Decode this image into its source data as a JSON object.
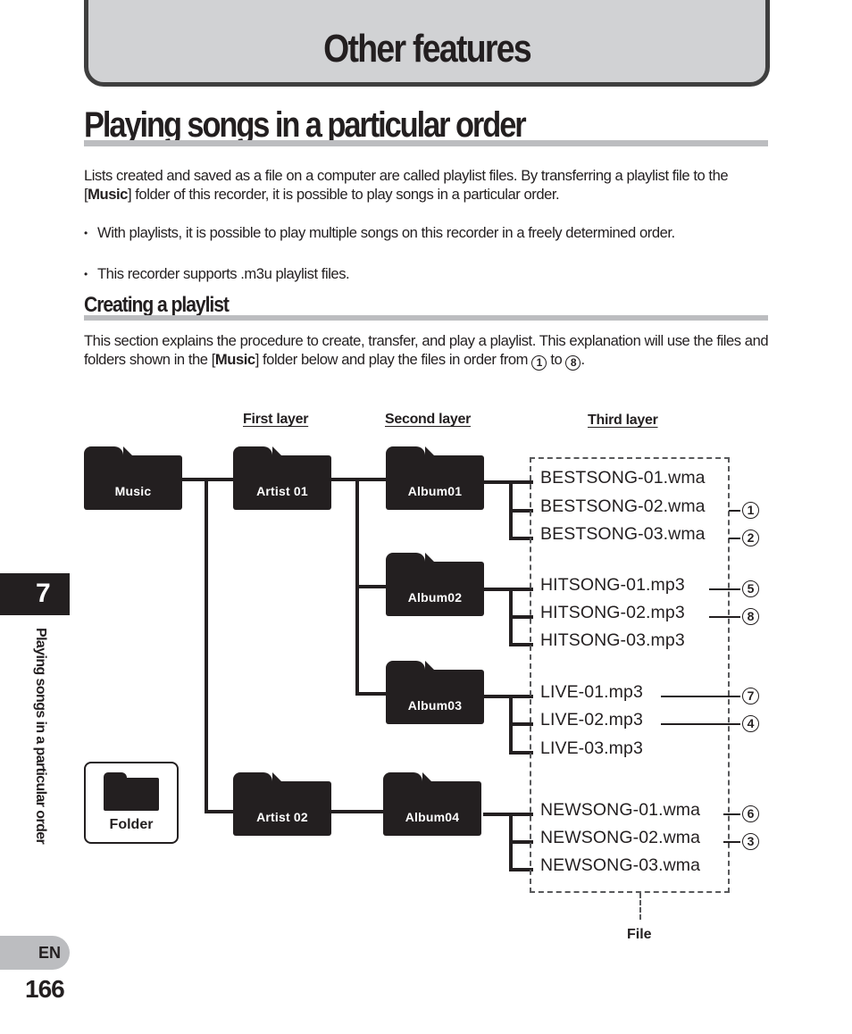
{
  "chapter": {
    "title": "Other features",
    "number": "7",
    "side_title": "Playing songs in a particular order"
  },
  "section": {
    "title": "Playing songs in a particular order",
    "intro_pre": "Lists created and saved as a file on a computer are called playlist files. By transferring a playlist file to the [",
    "intro_bold": "Music",
    "intro_post": "] folder of this recorder, it is possible to play songs in a particular order.",
    "bullets": [
      "With playlists, it is possible to play multiple songs on this recorder in a freely determined order.",
      "This recorder supports .m3u playlist files."
    ]
  },
  "subsection": {
    "title": "Creating a playlist",
    "text_pre": "This section explains the procedure to create, transfer, and play a playlist. This explanation will use the files and folders shown in the [",
    "text_bold": "Music",
    "text_mid": "] folder below and play the files in order from ",
    "order_start": "1",
    "text_to": " to ",
    "order_end": "8",
    "text_end": "."
  },
  "diagram": {
    "layer_labels": [
      "First layer",
      "Second layer",
      "Third layer"
    ],
    "root_folder": "Music",
    "folders": {
      "artist01": "Artist 01",
      "artist02": "Artist 02",
      "album01": "Album01",
      "album02": "Album02",
      "album03": "Album03",
      "album04": "Album04"
    },
    "files": [
      {
        "name": "BESTSONG-01.wma",
        "order": null
      },
      {
        "name": "BESTSONG-02.wma",
        "order": "1"
      },
      {
        "name": "BESTSONG-03.wma",
        "order": "2"
      },
      {
        "name": "HITSONG-01.mp3",
        "order": "5"
      },
      {
        "name": "HITSONG-02.mp3",
        "order": "8"
      },
      {
        "name": "HITSONG-03.mp3",
        "order": null
      },
      {
        "name": "LIVE-01.mp3",
        "order": "7"
      },
      {
        "name": "LIVE-02.mp3",
        "order": "4"
      },
      {
        "name": "LIVE-03.mp3",
        "order": null
      },
      {
        "name": "NEWSONG-01.wma",
        "order": "6"
      },
      {
        "name": "NEWSONG-02.wma",
        "order": "3"
      },
      {
        "name": "NEWSONG-03.wma",
        "order": null
      }
    ],
    "file_label": "File",
    "legend_label": "Folder"
  },
  "footer": {
    "language": "EN",
    "page_number": "166"
  }
}
